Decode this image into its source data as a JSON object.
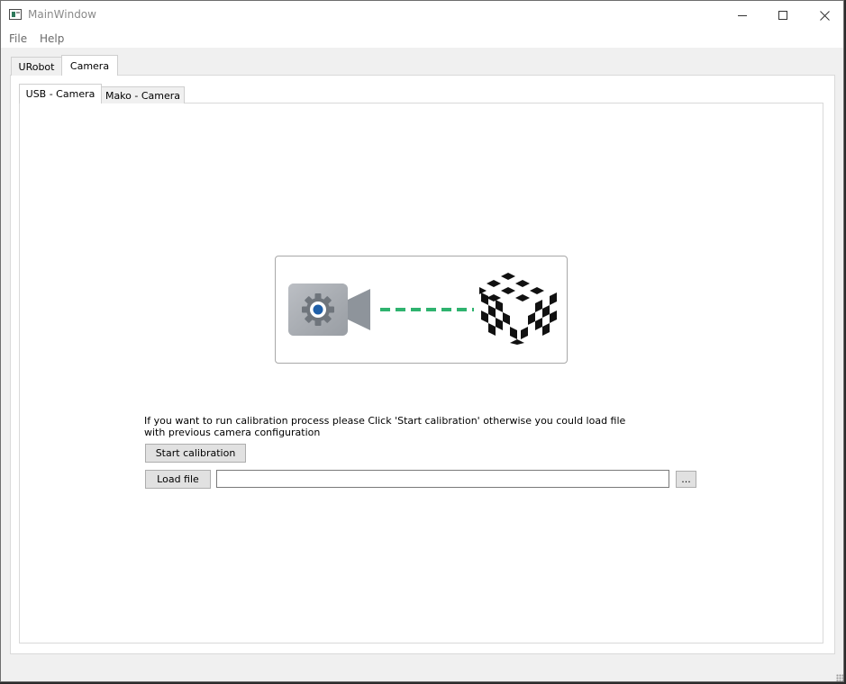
{
  "window": {
    "title": "MainWindow",
    "controls": {
      "minimize": "minimize-icon",
      "maximize": "maximize-icon",
      "close": "close-icon"
    }
  },
  "menu": {
    "file": "File",
    "help": "Help"
  },
  "outer_tabs": [
    {
      "label": "URobot",
      "active": false
    },
    {
      "label": "Camera",
      "active": true
    }
  ],
  "inner_tabs": [
    {
      "label": "USB - Camera",
      "active": true
    },
    {
      "label": "Mako - Camera",
      "active": false
    }
  ],
  "illustration": {
    "left_icon": "camera-settings-icon",
    "connector": "dashed-link",
    "right_icon": "checkerboard-cube-icon",
    "colors": {
      "connector": "#2fb36f",
      "camera_body": "#a9adb3",
      "lens": "#1f5fa8"
    }
  },
  "calibration": {
    "instructions": "If you want to run calibration process please Click 'Start calibration' otherwise you could load file with previous camera configuration",
    "start_button": "Start calibration",
    "load_button": "Load file",
    "file_path_value": "",
    "browse_button": "..."
  }
}
